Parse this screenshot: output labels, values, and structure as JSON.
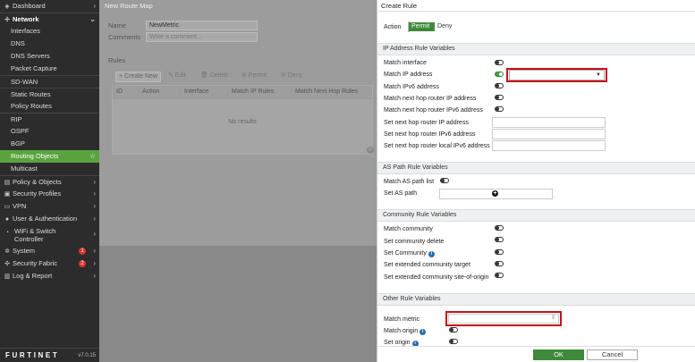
{
  "sidebar": {
    "items": [
      {
        "label": "Dashboard",
        "icon": "dashboard-icon",
        "glyph": "◈"
      },
      {
        "label": "Network",
        "icon": "network-icon",
        "glyph": "✢"
      },
      {
        "label": "Interfaces"
      },
      {
        "label": "DNS"
      },
      {
        "label": "DNS Servers"
      },
      {
        "label": "Packet Capture"
      },
      {
        "label": "SD-WAN"
      },
      {
        "label": "Static Routes"
      },
      {
        "label": "Policy Routes"
      },
      {
        "label": "RIP"
      },
      {
        "label": "OSPF"
      },
      {
        "label": "BGP"
      },
      {
        "label": "Routing Objects"
      },
      {
        "label": "Multicast"
      },
      {
        "label": "Policy & Objects",
        "icon": "policy-icon",
        "glyph": "▤"
      },
      {
        "label": "Security Profiles",
        "icon": "lock-icon",
        "glyph": "▣"
      },
      {
        "label": "VPN",
        "icon": "vpn-icon",
        "glyph": "▭"
      },
      {
        "label": "User & Authentication",
        "icon": "user-icon",
        "glyph": "●"
      },
      {
        "label": "WiFi & Switch Controller",
        "icon": "wifi-icon",
        "glyph": "◔"
      },
      {
        "label": "System",
        "icon": "gear-icon",
        "glyph": "✲",
        "badge": "1"
      },
      {
        "label": "Security Fabric",
        "icon": "fabric-icon",
        "glyph": "✣",
        "badge": "2"
      },
      {
        "label": "Log & Report",
        "icon": "log-icon",
        "glyph": "▥"
      }
    ],
    "chevron": "›",
    "expanded_chevron": "⌄",
    "star": "☆",
    "logo": "FURTINET",
    "version": "v7.0.15"
  },
  "main": {
    "title": "New Route Map",
    "name_label": "Name",
    "name_value": "NewMetric",
    "comments_label": "Comments",
    "comments_placeholder": "Write a comment...",
    "rules_label": "Rules",
    "toolbar": {
      "create_new": "+ Create New",
      "edit": "✎ Edit",
      "delete": "🗑 Delete",
      "permit": "⊘ Permit",
      "deny": "⊘ Deny"
    },
    "columns": [
      "ID",
      "Action",
      "Interface",
      "Match IP Rules",
      "Match Next Hop Rules"
    ],
    "no_results": "No results"
  },
  "panel": {
    "title": "Create Rule",
    "action_label": "Action",
    "permit": "Permit",
    "deny": "Deny",
    "ip_section": "IP Address Rule Variables",
    "match_interface": "Match interface",
    "match_ip_address": "Match IP address",
    "match_ipv6_address": "Match IPv6 address",
    "match_next_hop_ip": "Match next hop router IP address",
    "match_next_hop_ipv6": "Match next hop router IPv6 address",
    "set_next_hop_ip": "Set next hop router IP address",
    "set_next_hop_ipv6": "Set next hop router IPv6 address",
    "set_next_hop_local_ipv6": "Set next hop router local IPv6 address",
    "as_section": "AS Path Rule Variables",
    "match_as_path_list": "Match AS path list",
    "set_as_path": "Set AS path",
    "plus": "+",
    "community_section": "Community Rule Variables",
    "match_community": "Match community",
    "set_community_delete": "Set community delete",
    "set_community": "Set Community",
    "set_ext_community_target": "Set extended community target",
    "set_ext_community_soo": "Set extended community site-of-origin",
    "other_section": "Other Rule Variables",
    "match_metric": "Match metric",
    "match_origin": "Match origin",
    "set_origin": "Set origin",
    "info": "i",
    "ok": "OK",
    "cancel": "Cancel",
    "dropdown_caret": "▼",
    "spinner": "⇕"
  },
  "colors": {
    "accent": "#3f8a3a",
    "highlight": "#c4121a",
    "sidebar_bg": "#2c2c2c"
  }
}
